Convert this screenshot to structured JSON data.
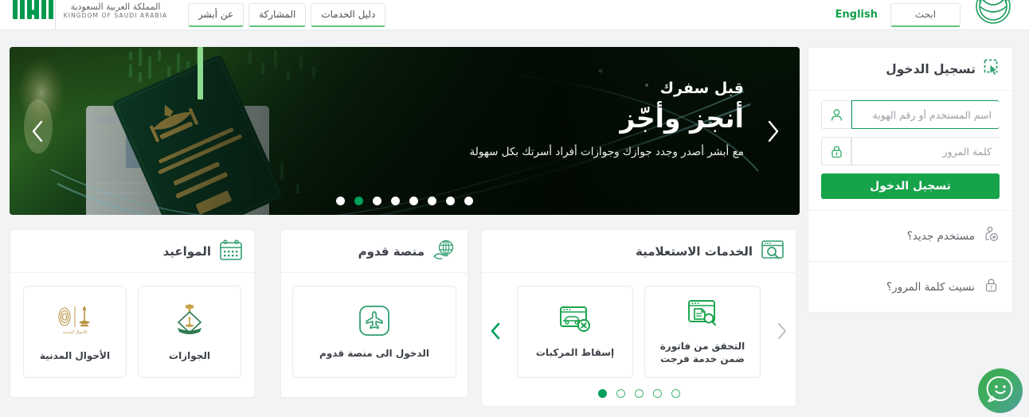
{
  "header": {
    "seal_icon": "saudi-national-emblem",
    "search_label": "ابحث",
    "language_label": "English",
    "nav_tabs": [
      {
        "label": "عن أبشر"
      },
      {
        "label": "المشاركة"
      },
      {
        "label": "دليل الخدمات"
      }
    ],
    "ksa_ar": "المملكة العربية السعودية",
    "ksa_en": "KINGDOM OF SAUDI ARABIA",
    "absher_logo": "absher-bars-logo"
  },
  "hero": {
    "kicker": "قبل سفرك",
    "title": "أنجز وأجّز",
    "subtitle": "مع أبشر أصدر وجدد جوازك وجوازات أفراد أسرتك بكل سهولة",
    "prev_icon": "chevron-left-icon",
    "next_icon": "chevron-right-icon",
    "dots_total": 8,
    "active_dot": 7,
    "image_alt": "saudi-passport-banner"
  },
  "login": {
    "title": "تسجيل الدخول",
    "title_icon": "cursor-select-icon",
    "username": {
      "icon": "user-icon",
      "value": "",
      "placeholder": "اسم المستخدم أو رقم الهوية",
      "focused": true
    },
    "password": {
      "icon": "lock-icon",
      "value": "",
      "placeholder": "كلمة المرور",
      "focused": false
    },
    "submit_label": "تسجيل الدخول",
    "links": [
      {
        "label": "مستخدم جديد؟",
        "icon": "user-add-icon"
      },
      {
        "label": "نسيت كلمة المرور؟",
        "icon": "lock-question-icon"
      }
    ]
  },
  "cards": [
    {
      "id": "appointments",
      "title": "المواعيد",
      "icon": "calendar-icon",
      "tiles": [
        {
          "label": "الأحوال المدنية",
          "icon": "civil-affairs-emblem"
        },
        {
          "label": "الجوازات",
          "icon": "passports-emblem"
        }
      ],
      "has_arrows": false,
      "dots_total": 0,
      "active_dot": 0
    },
    {
      "id": "qudum",
      "title": "منصة قدوم",
      "icon": "globe-hand-icon",
      "tiles": [
        {
          "label": "الدخول الى منصة قدوم",
          "icon": "airplane-icon"
        }
      ],
      "has_arrows": false,
      "dots_total": 0,
      "active_dot": 0
    },
    {
      "id": "inquiry-services",
      "title": "الخدمات الاستعلامية",
      "icon": "browser-search-icon",
      "tiles": [
        {
          "label": "إسقاط المركبات",
          "icon": "vehicle-remove-icon"
        },
        {
          "label": "التحقق من فاتورة ضمن خدمة فرجت",
          "icon": "document-search-icon"
        }
      ],
      "has_arrows": true,
      "prev_icon": "chevron-left-icon",
      "next_icon": "chevron-right-icon",
      "dots_total": 5,
      "active_dot": 5
    }
  ],
  "chat": {
    "icon": "chat-smiley-icon"
  },
  "colors": {
    "brand_green": "#00994d",
    "button_green": "#16a34a",
    "accent_light_green": "#8ddb8f",
    "page_bg": "#f2f3f4",
    "gold": "#b99343"
  }
}
